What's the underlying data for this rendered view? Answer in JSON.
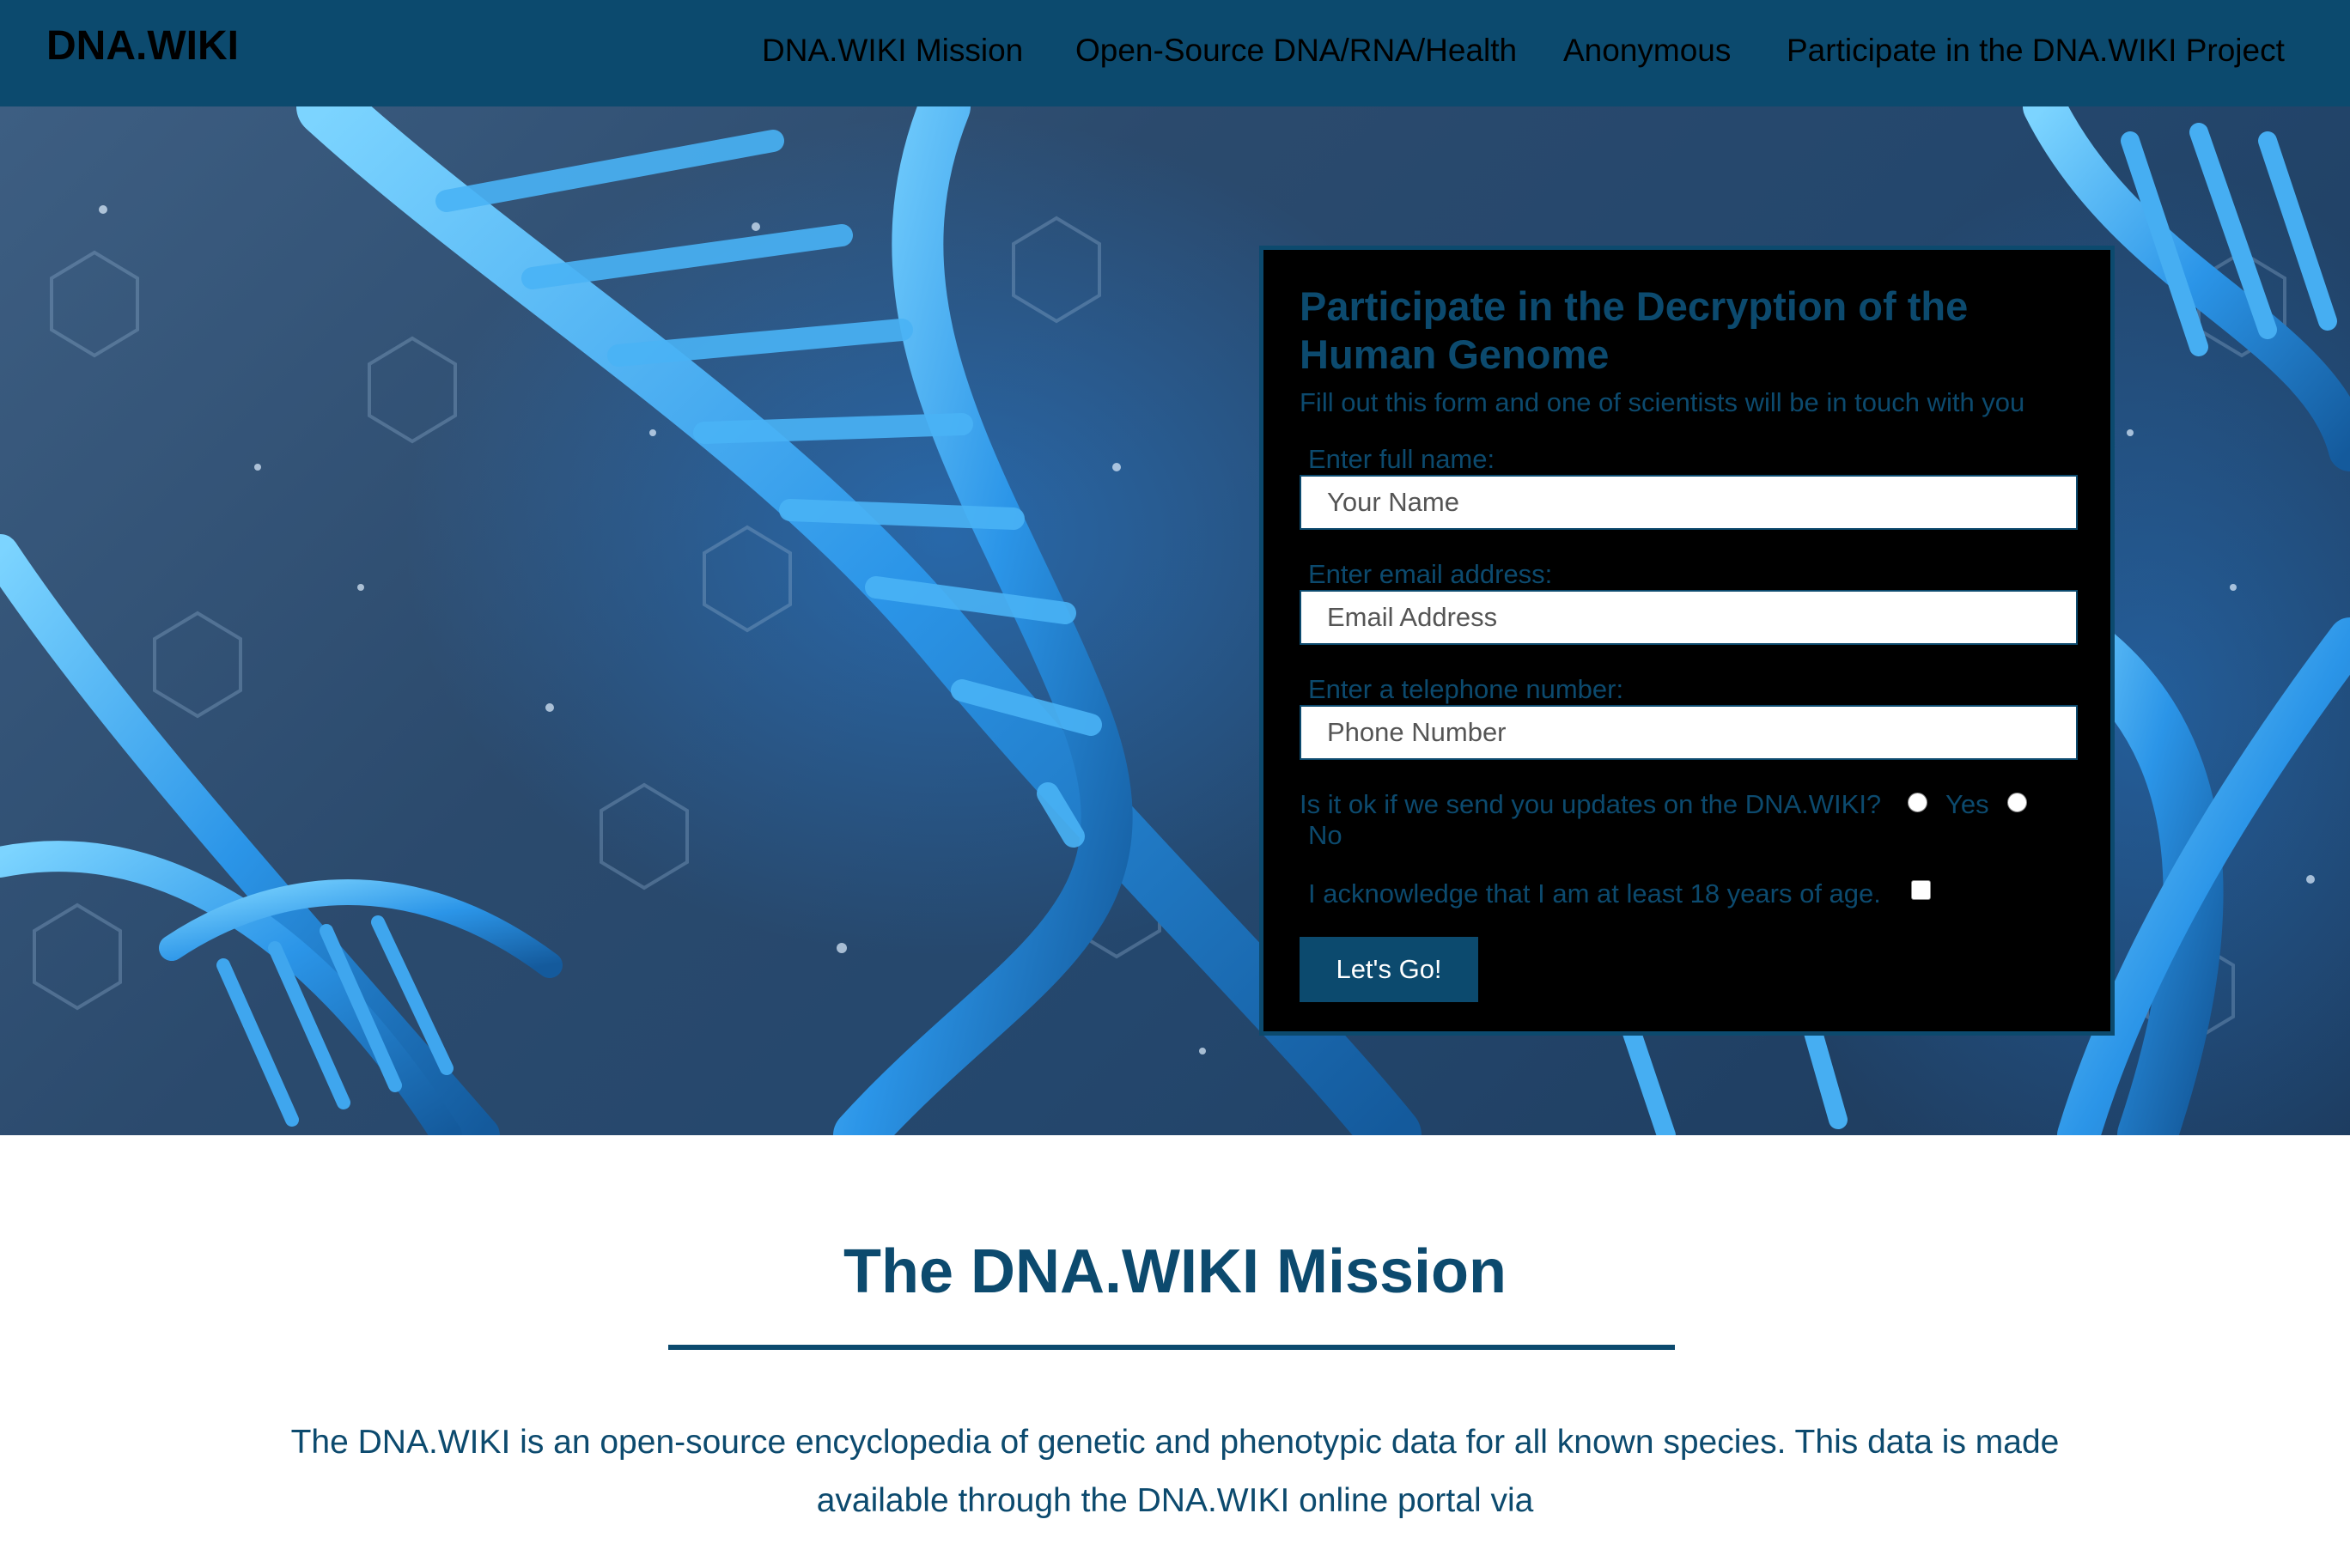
{
  "header": {
    "logo": "DNA.WIKI",
    "nav": [
      {
        "label": "DNA.WIKI Mission"
      },
      {
        "label": "Open-Source DNA/RNA/Health"
      },
      {
        "label": "Anonymous"
      },
      {
        "label": "Participate in the DNA.WIKI Project"
      }
    ]
  },
  "form": {
    "title": "Participate in the Decryption of the Human Genome",
    "subtitle": "Fill out this form and one of scientists will be in touch with you",
    "name_label": "Enter full name:",
    "name_placeholder": "Your Name",
    "email_label": "Enter email address:",
    "email_placeholder": "Email Address",
    "phone_label": "Enter a telephone number:",
    "phone_placeholder": "Phone Number",
    "updates_question": "Is it ok if we send you updates on the DNA.WIKI?",
    "yes_label": "Yes",
    "no_label": "No",
    "age_ack": "I acknowledge that I am at least 18 years of age.",
    "submit_label": "Let's Go!"
  },
  "mission": {
    "title": "The DNA.WIKI Mission",
    "text": "The DNA.WIKI is an open-source encyclopedia of genetic and phenotypic data for all known species. This data is made available through the DNA.WIKI online portal via"
  },
  "colors": {
    "brand": "#0c4a6e",
    "form_bg": "#000000",
    "dna_highlight": "#36a8f0"
  },
  "icons": {
    "hero_background": "dna-helix-image"
  }
}
